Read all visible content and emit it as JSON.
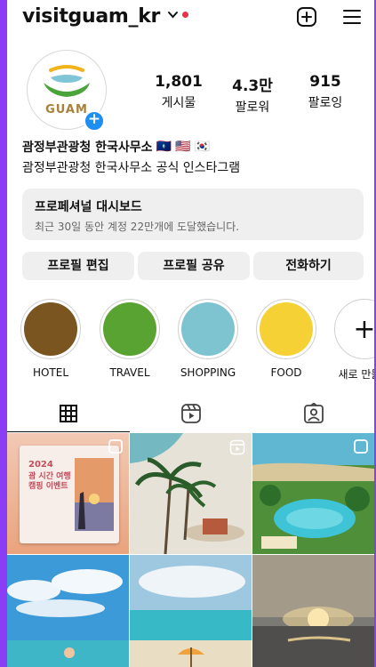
{
  "header": {
    "username": "visitguam_kr"
  },
  "profile": {
    "avatar_text": "GUAM",
    "stats": [
      {
        "value": "1,801",
        "label": "게시물"
      },
      {
        "value": "4.3만",
        "label": "팔로워"
      },
      {
        "value": "915",
        "label": "팔로잉"
      }
    ],
    "name": "괌정부관광청 한국사무소",
    "flags": [
      "🇬🇺",
      "🇺🇸",
      "🇰🇷"
    ],
    "bio": "괌정부관광청 한국사무소 공식 인스타그램"
  },
  "dashboard": {
    "title": "프로페셔널 대시보드",
    "subtitle": "최근 30일 동안 계정 22만개에 도달했습니다."
  },
  "buttons": {
    "edit": "프로필 편집",
    "share": "프로필 공유",
    "call": "전화하기"
  },
  "highlights": [
    {
      "label": "HOTEL",
      "color": "#7a5520"
    },
    {
      "label": "TRAVEL",
      "color": "#59a332"
    },
    {
      "label": "SHOPPING",
      "color": "#7ec4d0"
    },
    {
      "label": "FOOD",
      "color": "#f5d135"
    },
    {
      "label": "새로 만들기",
      "color": "#ffffff"
    }
  ],
  "posts": {
    "promo_year": "2024",
    "promo_title": "괌 시간 여행 캠핑 이벤트"
  },
  "colors": {
    "accent_blue": "#1f8ef1",
    "notification_red": "#e8324a",
    "frame_purple": "#8a3df5"
  }
}
